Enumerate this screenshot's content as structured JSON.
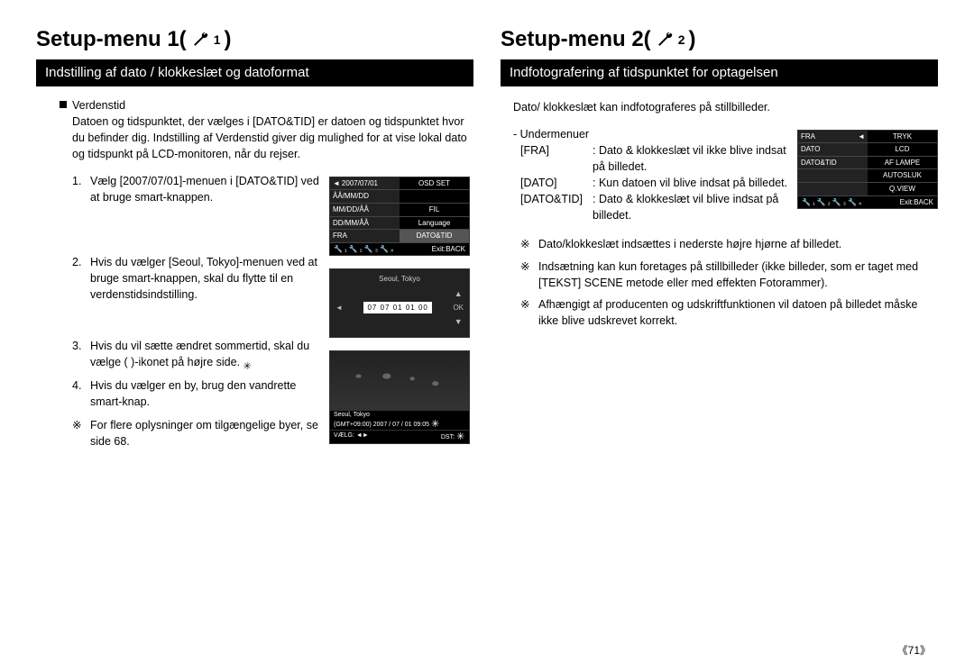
{
  "left": {
    "title_prefix": "Setup-menu 1(",
    "title_suffix": ")",
    "subtitle": "Indstilling af dato / klokkeslæt og datoformat",
    "section_label": "Verdenstid",
    "intro": "Datoen og tidspunktet, der vælges i [DATO&TID] er datoen og tidspunktet hvor du befinder dig. Indstilling af Verdenstid giver dig mulighed for at vise lokal dato og tidspunkt på LCD-monitoren, når du rejser.",
    "steps": [
      "Vælg [2007/07/01]-menuen i [DATO&TID] ved at bruge smart-knappen.",
      "Hvis du vælger [Seoul, Tokyo]-menuen ved at bruge smart-knappen, skal du flytte til en verdenstidsindstilling.",
      "Hvis du vil sætte ændret sommertid, skal du vælge (   )-ikonet på højre side.",
      "Hvis du vælger en by, brug den vandrette smart-knap."
    ],
    "note_sym": "※",
    "note": "For flere oplysninger om tilgængelige byer, se side 68.",
    "lcd1": {
      "date": "2007/07/01",
      "right_rows": [
        "OSD SET",
        "",
        "FIL",
        "Language",
        "DATO&TID"
      ],
      "left_rows": [
        "ÅÅ/MM/DD",
        "MM/DD/ÅÅ",
        "DD/MM/ÅÅ",
        "FRA"
      ],
      "exit": "Exit:BACK"
    },
    "lcd2": {
      "city": "Seoul, Tokyo",
      "date": "07  07  01  01  00",
      "ok": "OK"
    },
    "lcd3": {
      "city": "Seoul, Tokyo",
      "gmt": "(GMT+09:00) 2007 / 07 / 01  09:05",
      "select": "VÆLG:",
      "dst": "DST:"
    }
  },
  "right": {
    "title_prefix": "Setup-menu 2(",
    "title_suffix": ")",
    "subtitle": "Indfotografering af tidspunktet for optagelsen",
    "intro": "Dato/ klokkeslæt kan indfotograferes på stillbilleder.",
    "sub_label": "- Undermenuer",
    "rows": [
      {
        "k": "[FRA]",
        "v": ": Dato & klokkeslæt vil ikke blive indsat på billedet."
      },
      {
        "k": "[DATO]",
        "v": ": Kun datoen vil blive indsat på billedet."
      },
      {
        "k": "[DATO&TID]",
        "v": ": Dato & klokkeslæt vil blive indsat på billedet."
      }
    ],
    "note_sym": "※",
    "notes": [
      "Dato/klokkeslæt indsættes i nederste højre hjørne af billedet.",
      "Indsætning kan kun foretages på stillbilleder (ikke billeder, som er taget med [TEKST] SCENE metode eller med effekten Fotorammer).",
      "Afhængigt af producenten og udskriftfunktionen vil datoen på billedet måske ikke blive udskrevet korrekt."
    ],
    "lcd": {
      "left_rows": [
        "FRA",
        "DATO",
        "DATO&TID"
      ],
      "right_rows": [
        "TRYK",
        "LCD",
        "AF LAMPE",
        "AUTOSLUK",
        "Q.VIEW"
      ],
      "exit": "Exit:BACK"
    }
  },
  "page_no": "《71》"
}
